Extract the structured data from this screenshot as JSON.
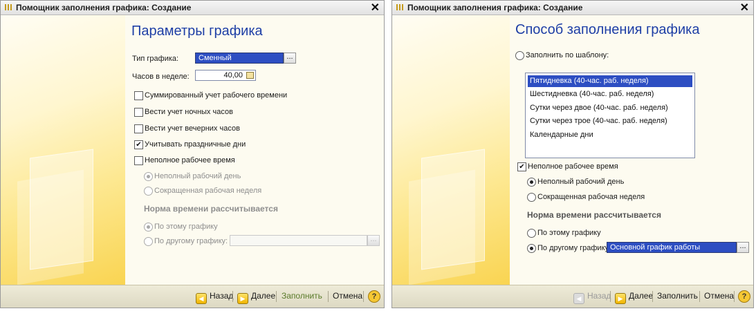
{
  "left": {
    "window_title": "Помощник заполнения графика: Создание",
    "close": "✕",
    "heading": "Параметры графика",
    "type_label": "Тип графика:",
    "type_value": "Сменный",
    "hours_label": "Часов в неделе:",
    "hours_value": "40,00",
    "checkboxes": [
      {
        "label": "Суммированный учет рабочего времени",
        "checked": false,
        "mark": ""
      },
      {
        "label": "Вести учет ночных часов",
        "checked": false,
        "mark": ""
      },
      {
        "label": "Вести учет вечерних часов",
        "checked": false,
        "mark": ""
      },
      {
        "label": "Учитывать праздничные дни",
        "checked": true,
        "mark": "✔"
      },
      {
        "label": "Неполное рабочее время",
        "checked": false,
        "mark": ""
      }
    ],
    "parttime_options": [
      "Неполный рабочий день",
      "Сокращенная рабочая неделя"
    ],
    "norm_heading": "Норма времени рассчитывается",
    "norm_options": [
      "По этому графику",
      "По другому графику:"
    ],
    "other_schedule_value": "",
    "dots": "..."
  },
  "right": {
    "window_title": "Помощник заполнения графика: Создание",
    "close": "✕",
    "heading": "Способ заполнения графика",
    "template_radio": "Заполнить по шаблону:",
    "templates": [
      "Пятидневка (40-час. раб. неделя)",
      "Шестидневка (40-час. раб. неделя)",
      "Сутки через двое (40-час. раб. неделя)",
      "Сутки через трое (40-час. раб. неделя)",
      "Календарные дни"
    ],
    "selected_template_index": 0,
    "parttime_checkbox": "Неполное рабочее время",
    "parttime_mark": "✔",
    "parttime_options": [
      "Неполный рабочий день",
      "Сокращенная рабочая неделя"
    ],
    "norm_heading": "Норма времени рассчитывается",
    "norm_options": [
      "По этому графику",
      "По другому графику:"
    ],
    "other_schedule_value": "Основной график работы",
    "dots": "..."
  },
  "buttons": {
    "back": "Назад",
    "next": "Далее",
    "fill": "Заполнить",
    "cancel": "Отмена",
    "help": "?",
    "back_icon": "◀",
    "next_icon": "▶"
  },
  "colors": {
    "heading": "#1e3fa6",
    "selection": "#2d4ec2",
    "arrow": "#d23a16"
  }
}
